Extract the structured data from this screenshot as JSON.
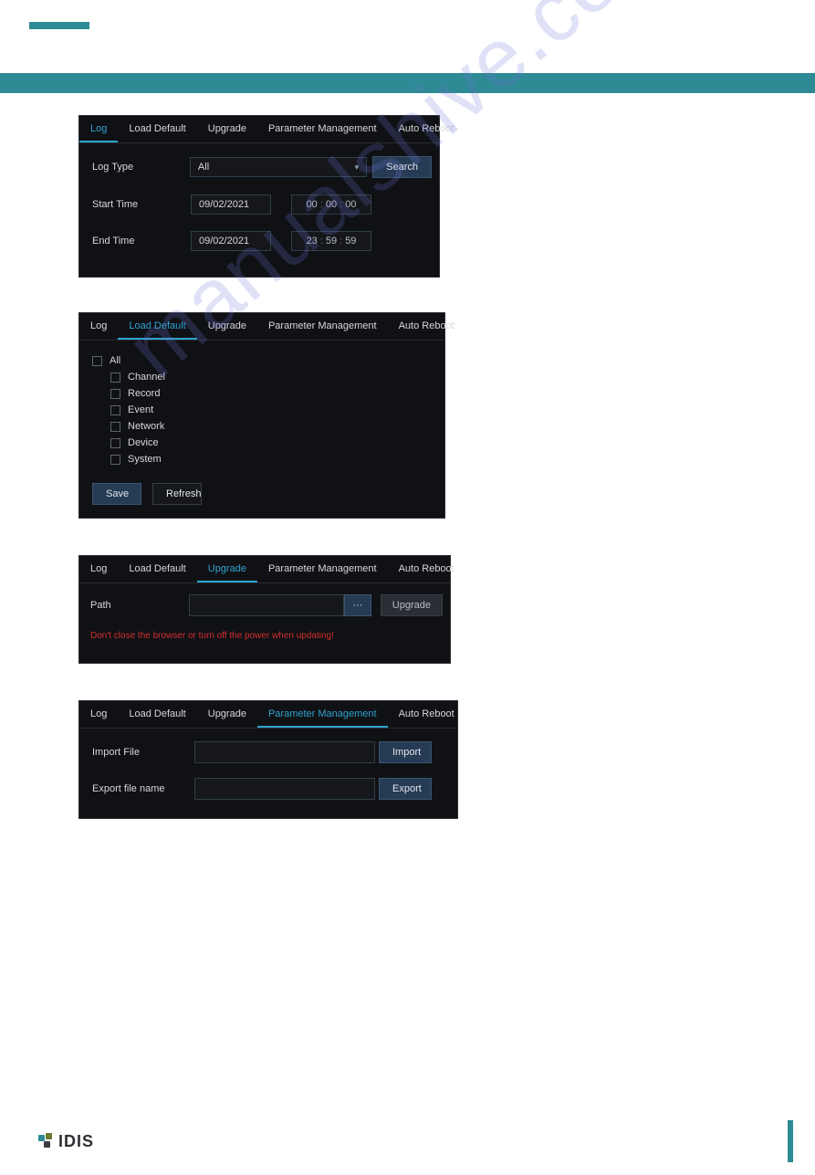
{
  "tabs": {
    "log": "Log",
    "load_default": "Load Default",
    "upgrade": "Upgrade",
    "param_mgmt": "Parameter Management",
    "auto_reboot": "Auto Reboot"
  },
  "panel_log": {
    "log_type_label": "Log Type",
    "log_type_value": "All",
    "search": "Search",
    "start_time_label": "Start Time",
    "start_date": "09/02/2021",
    "start_h": "00",
    "start_m": "00",
    "start_s": "00",
    "end_time_label": "End Time",
    "end_date": "09/02/2021",
    "end_h": "23",
    "end_m": "59",
    "end_s": "59"
  },
  "panel_default": {
    "all": "All",
    "channel": "Channel",
    "record": "Record",
    "event": "Event",
    "network": "Network",
    "device": "Device",
    "system": "System",
    "save": "Save",
    "refresh": "Refresh"
  },
  "panel_upgrade": {
    "path_label": "Path",
    "browse": "···",
    "upgrade_btn": "Upgrade",
    "warning": "Don't close the browser or turn off the power when updating!"
  },
  "panel_param": {
    "import_label": "Import File",
    "import_btn": "Import",
    "export_label": "Export file name",
    "export_btn": "Export"
  },
  "footer": {
    "brand": "IDIS"
  },
  "watermark": "manualshive.com"
}
